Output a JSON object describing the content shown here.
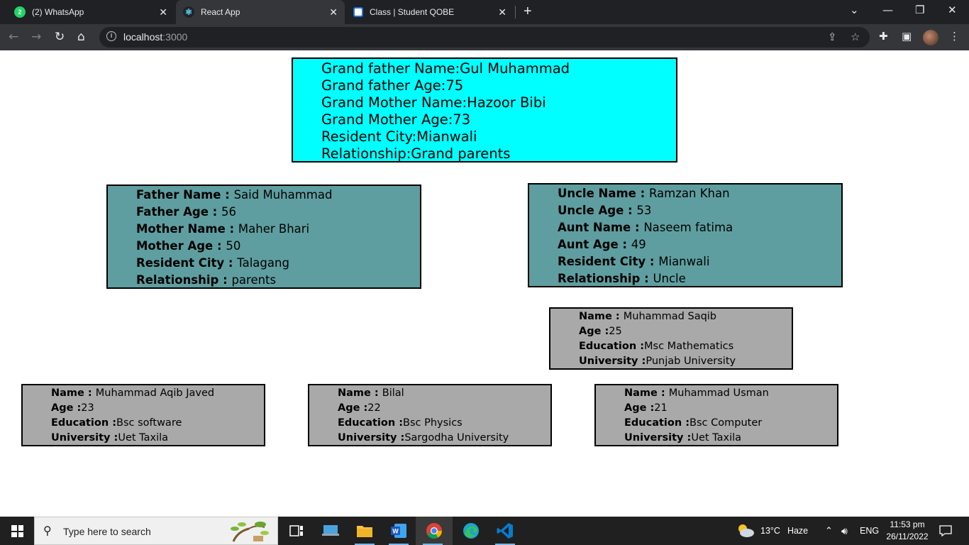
{
  "browser": {
    "tabs": [
      {
        "title": "(2) WhatsApp",
        "favicon": "whatsapp-icon"
      },
      {
        "title": "React App",
        "favicon": "react-icon",
        "active": true
      },
      {
        "title": "Class | Student QOBE",
        "favicon": "qobe-icon"
      }
    ],
    "new_tab": "+",
    "url_host": "localhost",
    "url_port": ":3000"
  },
  "grandparents": {
    "lines": [
      {
        "label": "Grand father Name:",
        "value": "Gul Muhammad"
      },
      {
        "label": "Grand father Age:",
        "value": "75"
      },
      {
        "label": "Grand Mother Name:",
        "value": "Hazoor Bibi"
      },
      {
        "label": "Grand Mother Age:",
        "value": "73"
      },
      {
        "label": "Resident City:",
        "value": "Mianwali"
      },
      {
        "label": "Relationship:",
        "value": "Grand parents"
      }
    ]
  },
  "parents": {
    "lines": [
      {
        "label": "Father Name : ",
        "value": "Said Muhammad"
      },
      {
        "label": "Father Age : ",
        "value": "56"
      },
      {
        "label": "Mother Name : ",
        "value": "Maher Bhari"
      },
      {
        "label": "Mother Age : ",
        "value": "50"
      },
      {
        "label": "Resident City : ",
        "value": "Talagang"
      },
      {
        "label": "Relationship : ",
        "value": "parents"
      }
    ]
  },
  "uncle": {
    "lines": [
      {
        "label": "Uncle Name : ",
        "value": "Ramzan Khan"
      },
      {
        "label": "Uncle Age : ",
        "value": "53"
      },
      {
        "label": "Aunt Name : ",
        "value": "Naseem fatima"
      },
      {
        "label": "Aunt Age : ",
        "value": "49"
      },
      {
        "label": "Resident City : ",
        "value": "Mianwali"
      },
      {
        "label": "Relationship : ",
        "value": "Uncle"
      }
    ]
  },
  "cousin": {
    "lines": [
      {
        "label": "Name : ",
        "value": "Muhammad Saqib"
      },
      {
        "label": "Age :",
        "value": "25"
      },
      {
        "label": "Education :",
        "value": "Msc Mathematics"
      },
      {
        "label": "University :",
        "value": "Punjab University"
      }
    ]
  },
  "children": [
    {
      "lines": [
        {
          "label": "Name : ",
          "value": "Muhammad Aqib Javed"
        },
        {
          "label": "Age :",
          "value": "23"
        },
        {
          "label": "Education :",
          "value": "Bsc software"
        },
        {
          "label": "University :",
          "value": "Uet Taxila"
        }
      ]
    },
    {
      "lines": [
        {
          "label": "Name : ",
          "value": "Bilal"
        },
        {
          "label": "Age :",
          "value": "22"
        },
        {
          "label": "Education :",
          "value": "Bsc Physics"
        },
        {
          "label": "University :",
          "value": "Sargodha University"
        }
      ]
    },
    {
      "lines": [
        {
          "label": "Name : ",
          "value": "Muhammad Usman"
        },
        {
          "label": "Age :",
          "value": "21"
        },
        {
          "label": "Education :",
          "value": "Bsc Computer"
        },
        {
          "label": "University :",
          "value": "Uet Taxila"
        }
      ]
    }
  ],
  "taskbar": {
    "search_placeholder": "Type here to search",
    "weather_temp": "13°C",
    "weather_desc": "Haze",
    "language": "ENG",
    "time": "11:53 pm",
    "date": "26/11/2022"
  },
  "colors": {
    "grandparents_bg": "#00ffff",
    "parents_bg": "#5f9ea0",
    "children_bg": "#a9a9a9"
  }
}
